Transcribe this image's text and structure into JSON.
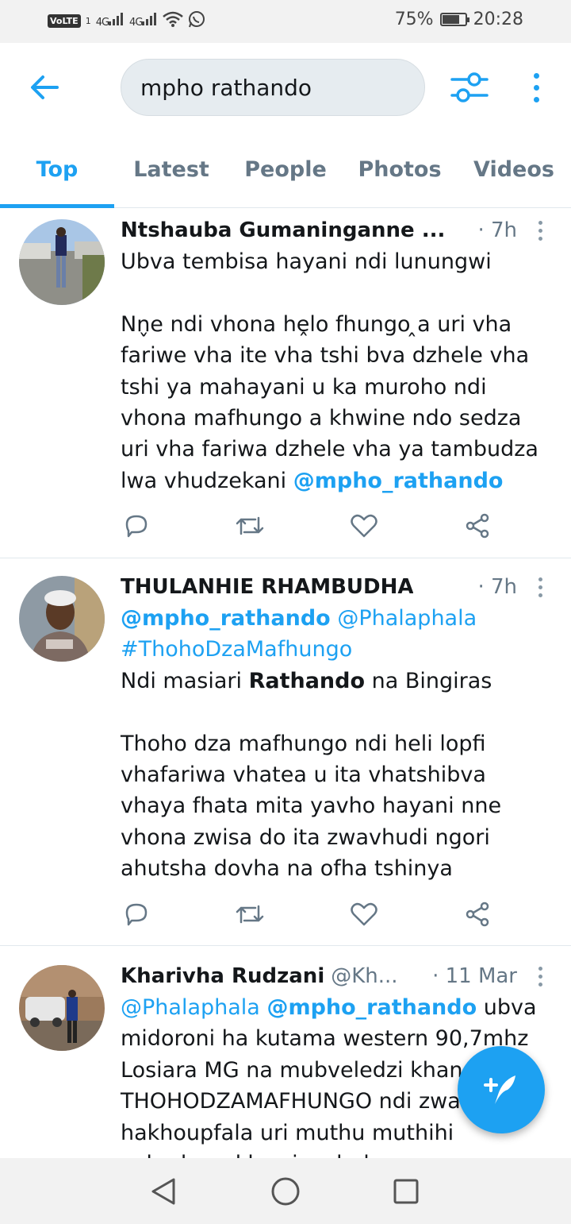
{
  "status_bar": {
    "volte": "VoLTE",
    "sim": "1",
    "network_1": "4G",
    "network_2": "4G",
    "battery_percent": "75%",
    "battery_level": 0.75,
    "time": "20:28"
  },
  "search": {
    "query": "mpho rathando"
  },
  "tabs": [
    {
      "label": "Top",
      "active": true
    },
    {
      "label": "Latest",
      "active": false
    },
    {
      "label": "People",
      "active": false
    },
    {
      "label": "Photos",
      "active": false
    },
    {
      "label": "Videos",
      "active": false
    }
  ],
  "tweets": [
    {
      "name": "Ntshauba Gumaninganne ...",
      "handle": "",
      "time": "· 7h",
      "text_1": "Ubva tembisa hayani ndi lunungwi\n\nNn̬e ndi vhona hḙlo fhungo ̭a uri vha fariwe vha ite vha tshi bva dzhele vha tshi ya mahayani u ka muroho ndi vhona mafhungo a khwine ndo sedza uri vha fariwa dzhele vha ya tambudza lwa vhudzekani ",
      "mention_1": "@mpho_rathando"
    },
    {
      "name": "THULANHIE RHAMBUDHA",
      "handle": "",
      "time": "· 7h",
      "mention_1": "@mpho_rathando",
      "link_1": "@Phalaphala",
      "hashtag": "#ThohoDzaMafhungo",
      "text_1": "Ndi masiari ",
      "bold_1": "Rathando",
      "text_2": " na Bingiras\n\nThoho dza mafhungo ndi heli lopfi vhafariwa vhatea u ita vhatshibva vhaya fhata mita yavho hayani nne vhona zwisa do ita zwavhudi ngori ahutsha dovha na ofha tshinya"
    },
    {
      "name": "Kharivha Rudzani",
      "handle": "@Kh...",
      "time": "· 11 Mar",
      "link_1": "@Phalaphala",
      "mention_1": "@mpho_rathando",
      "text_1": " ubva midoroni ha kutama western 90,7mhz Losiara MG na mubveledzi khan THOHODZAMAFHUNGO ndi zwa hakhoupfala uri muthu muthihi vahadzwa khwaiyavhulaaya"
    }
  ],
  "icons": {
    "back": "arrow-left-icon",
    "filter": "filter-sliders-icon",
    "more": "more-vertical-icon",
    "reply": "reply-icon",
    "retweet": "retweet-icon",
    "like": "heart-icon",
    "share": "share-icon",
    "compose": "compose-tweet-icon"
  },
  "colors": {
    "accent": "#1da1f2",
    "text": "#14171a",
    "secondary": "#657786"
  }
}
